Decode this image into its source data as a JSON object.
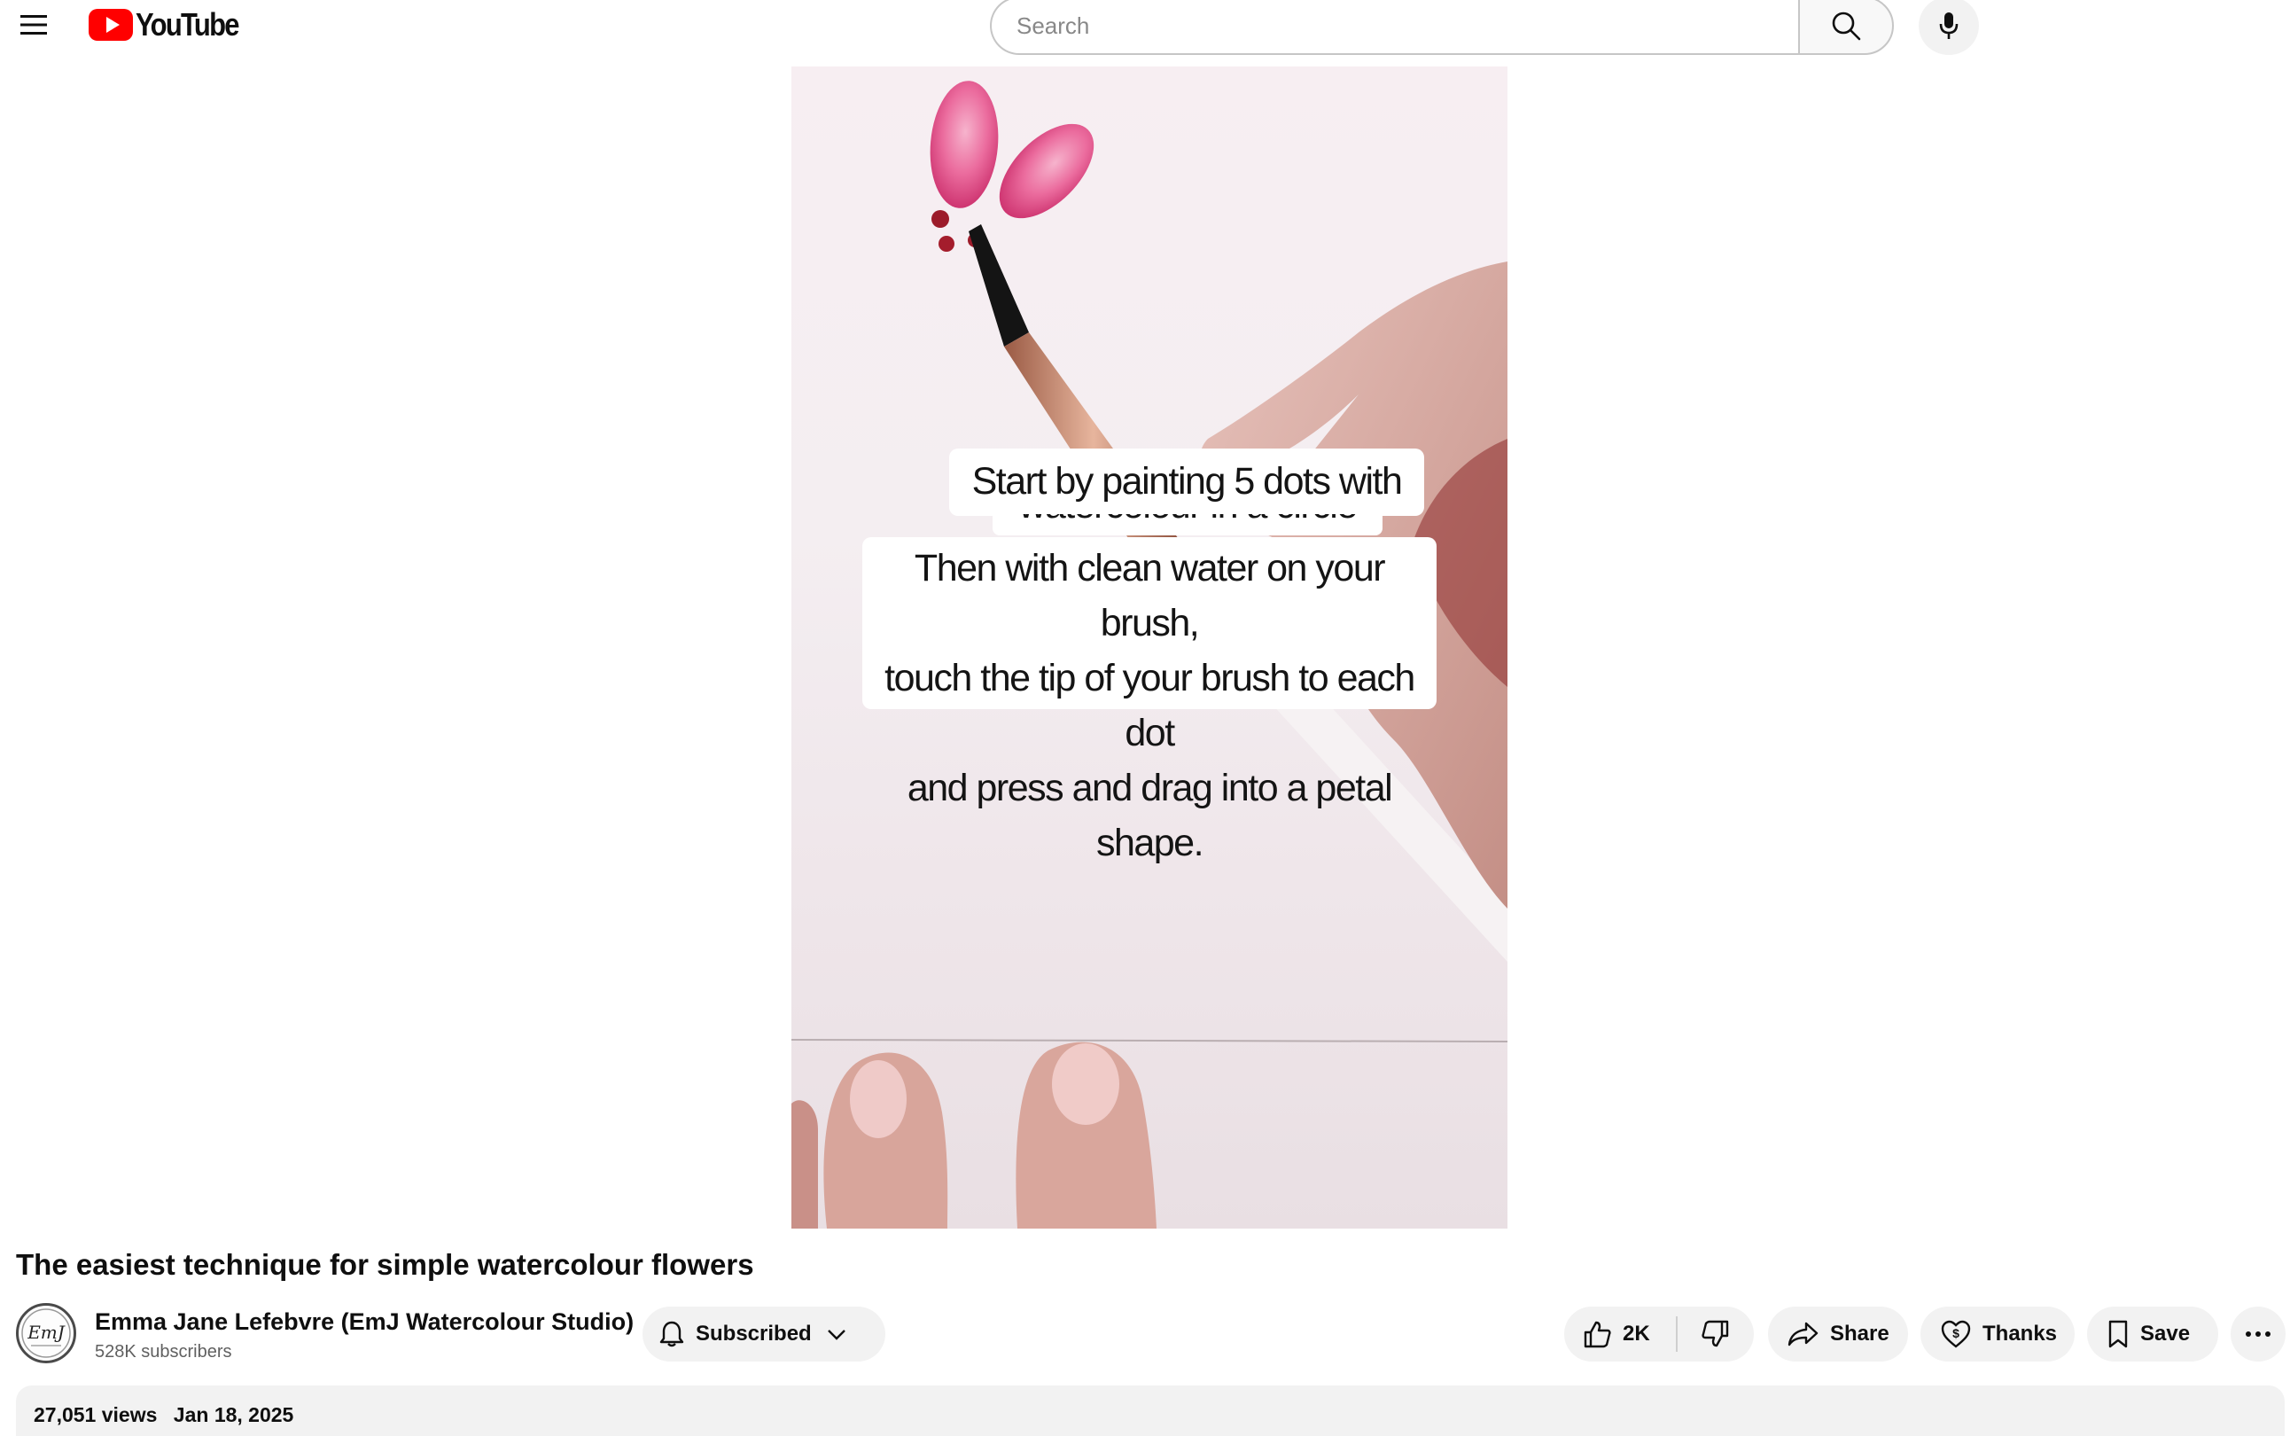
{
  "app": {
    "logo_text": "YouTube",
    "brand_color": "#ff0000"
  },
  "search": {
    "placeholder": "Search",
    "value": ""
  },
  "icons": {
    "menu": "hamburger-menu-icon",
    "search": "magnifier-search-icon",
    "mic": "microphone-icon",
    "bell": "bell-icon",
    "chevron": "chevron-down-icon",
    "like": "thumbs-up-icon",
    "dislike": "thumbs-down-icon",
    "share": "share-arrow-icon",
    "thanks": "heart-dollar-icon",
    "save": "bookmark-icon",
    "more": "more-horizontal-icon"
  },
  "player": {
    "captions": [
      "Start by painting 5 dots with",
      "watercolour in a circle",
      "Then with clean water on your brush,",
      "touch the tip of your brush to each dot",
      "and press and drag into a petal shape."
    ]
  },
  "video": {
    "title": "The easiest technique for simple watercolour flowers",
    "views": "27,051 views",
    "date": "Jan 18, 2025"
  },
  "channel": {
    "name": "Emma Jane Lefebvre (EmJ Watercolour Studio)",
    "subscribers": "528K subscribers",
    "avatar_text": "EmJ"
  },
  "actions": {
    "subscribed_label": "Subscribed",
    "like_count": "2K",
    "share_label": "Share",
    "thanks_label": "Thanks",
    "save_label": "Save"
  }
}
